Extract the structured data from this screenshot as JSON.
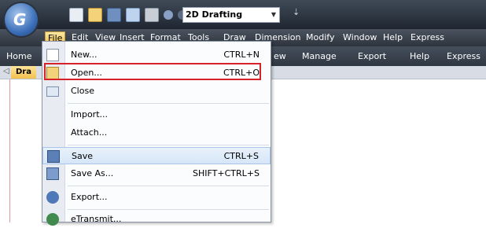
{
  "qat": {
    "workspace": "2D Drafting",
    "extra_glyph": "⇣"
  },
  "menubar": {
    "items": [
      {
        "label": "File"
      },
      {
        "label": "Edit"
      },
      {
        "label": "View"
      },
      {
        "label": "Insert"
      },
      {
        "label": "Format"
      },
      {
        "label": "Tools"
      },
      {
        "label": "Draw"
      },
      {
        "label": "Dimension"
      },
      {
        "label": "Modify"
      },
      {
        "label": "Window"
      },
      {
        "label": "Help"
      },
      {
        "label": "Express"
      }
    ]
  },
  "ribbon": {
    "tabs": [
      {
        "label": "Home"
      },
      {
        "label": "ew"
      },
      {
        "label": "Manage"
      },
      {
        "label": "Export"
      },
      {
        "label": "Help"
      },
      {
        "label": "Express"
      }
    ]
  },
  "doc_tabs": {
    "nav_glyph": "◁",
    "current": "Dra"
  },
  "file_menu": {
    "items": [
      {
        "label": "New...",
        "shortcut": "CTRL+N",
        "icon": "new-file-icon"
      },
      {
        "label": "Open...",
        "shortcut": "CTRL+O",
        "icon": "open-folder-icon"
      },
      {
        "label": "Close",
        "shortcut": "",
        "icon": "close-folder-icon"
      },
      {
        "label": "Import...",
        "shortcut": ""
      },
      {
        "label": "Attach...",
        "shortcut": ""
      },
      {
        "label": "Save",
        "shortcut": "CTRL+S",
        "icon": "save-icon"
      },
      {
        "label": "Save As...",
        "shortcut": "SHIFT+CTRL+S",
        "icon": "save-as-icon"
      },
      {
        "label": "Export...",
        "shortcut": "",
        "icon": "export-icon"
      },
      {
        "label": "eTransmit...",
        "shortcut": "",
        "icon": "etransmit-icon"
      }
    ]
  },
  "colors": {
    "highlight": "#d6232a",
    "active_menu": "#f2c45a"
  }
}
